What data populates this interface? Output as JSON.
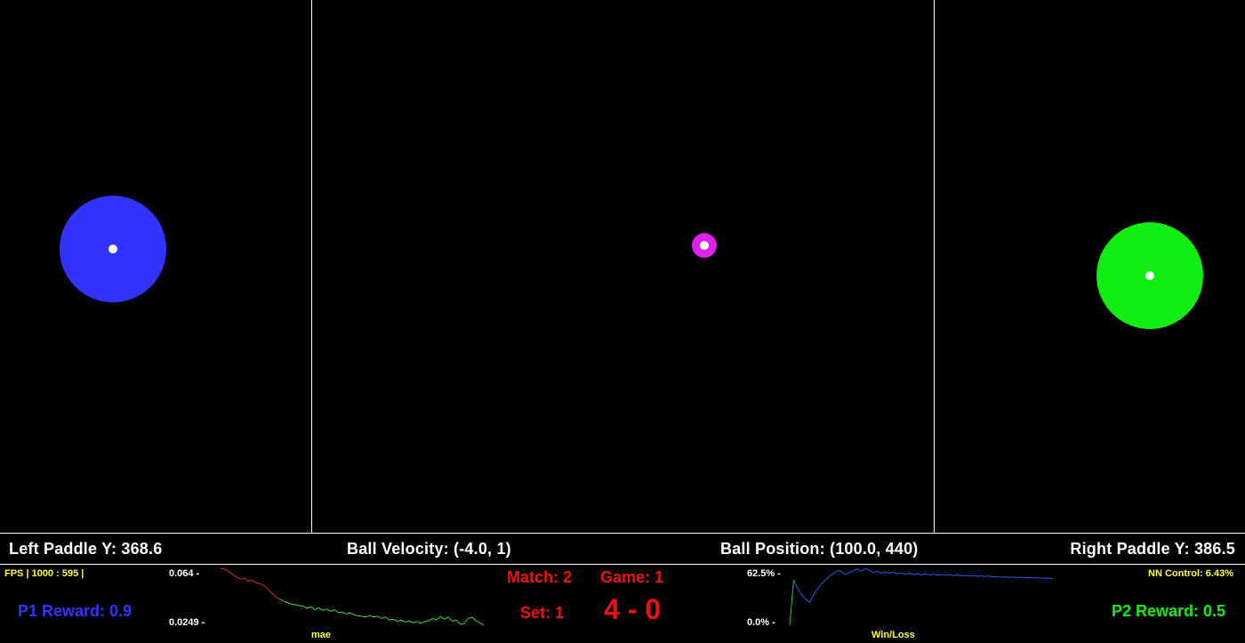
{
  "colors": {
    "background": "#000000",
    "divider": "#ffffff",
    "p1": "#3333ff",
    "p2": "#11ee11",
    "ball": "#dd22ee",
    "score": "#ee1111",
    "label_yellow": "#ffff33",
    "mae_early": "#dd3311",
    "mae_late": "#33dd33",
    "winloss_line": "#3355ee",
    "winloss_start": "#22cc22"
  },
  "status_bar": {
    "left_paddle_label": "Left Paddle Y: 368.6",
    "ball_velocity_label": "Ball Velocity: (-4.0, 1)",
    "ball_position_label": "Ball Position: (100.0, 440)",
    "right_paddle_label": "Right Paddle Y: 386.5"
  },
  "hud": {
    "fps_label": "FPS | 1000 : 595 |",
    "nn_control_label": "NN Control: 6.43%",
    "p1_reward": "P1 Reward: 0.9",
    "p2_reward": "P2 Reward: 0.5"
  },
  "score": {
    "match": "Match: 2",
    "game": "Game: 1",
    "set": "Set: 1",
    "points": "4 - 0"
  },
  "mae_graph": {
    "max_label": "0.064 -",
    "min_label": "0.0249 -",
    "caption": "mae",
    "values": [
      0.064,
      0.0635,
      0.062,
      0.06,
      0.058,
      0.0565,
      0.0575,
      0.055,
      0.056,
      0.054,
      0.0535,
      0.052,
      0.05,
      0.047,
      0.0445,
      0.043,
      0.0415,
      0.0405,
      0.0395,
      0.039,
      0.0385,
      0.038,
      0.0365,
      0.0375,
      0.0355,
      0.037,
      0.035,
      0.036,
      0.0345,
      0.0355,
      0.0335,
      0.034,
      0.0325,
      0.0335,
      0.032,
      0.0315,
      0.031,
      0.0305,
      0.0315,
      0.0305,
      0.031,
      0.0295,
      0.0305,
      0.0285,
      0.029,
      0.0275,
      0.0285,
      0.027,
      0.028,
      0.0265,
      0.0275,
      0.026,
      0.0275,
      0.028,
      0.0295,
      0.0285,
      0.031,
      0.029,
      0.0305,
      0.0275,
      0.0285,
      0.0255,
      0.026,
      0.0295,
      0.0305,
      0.028,
      0.0265,
      0.0249
    ]
  },
  "winloss_graph": {
    "max_label": "62.5% -",
    "min_label": "0.0% -",
    "caption": "Win/Loss",
    "values": [
      0.0,
      50.0,
      40.0,
      33.3,
      28.6,
      25.0,
      33.3,
      40.0,
      45.5,
      50.0,
      53.8,
      57.1,
      60.0,
      58.8,
      55.6,
      57.9,
      60.0,
      61.9,
      59.1,
      62.5,
      60.0,
      57.7,
      59.3,
      57.1,
      58.6,
      56.7,
      58.1,
      56.3,
      57.6,
      55.9,
      57.1,
      55.6,
      56.8,
      55.3,
      56.4,
      55.0,
      56.1,
      54.8,
      55.8,
      54.5,
      55.6,
      54.3,
      55.3,
      54.2,
      54.8,
      53.9,
      54.5,
      53.7,
      54.2,
      53.4,
      53.9,
      52.9,
      53.5,
      52.6,
      53.2,
      52.5,
      53.0,
      52.3,
      52.7,
      52.0,
      52.4,
      51.8,
      52.1,
      51.6,
      51.8,
      51.5,
      51.7
    ]
  }
}
